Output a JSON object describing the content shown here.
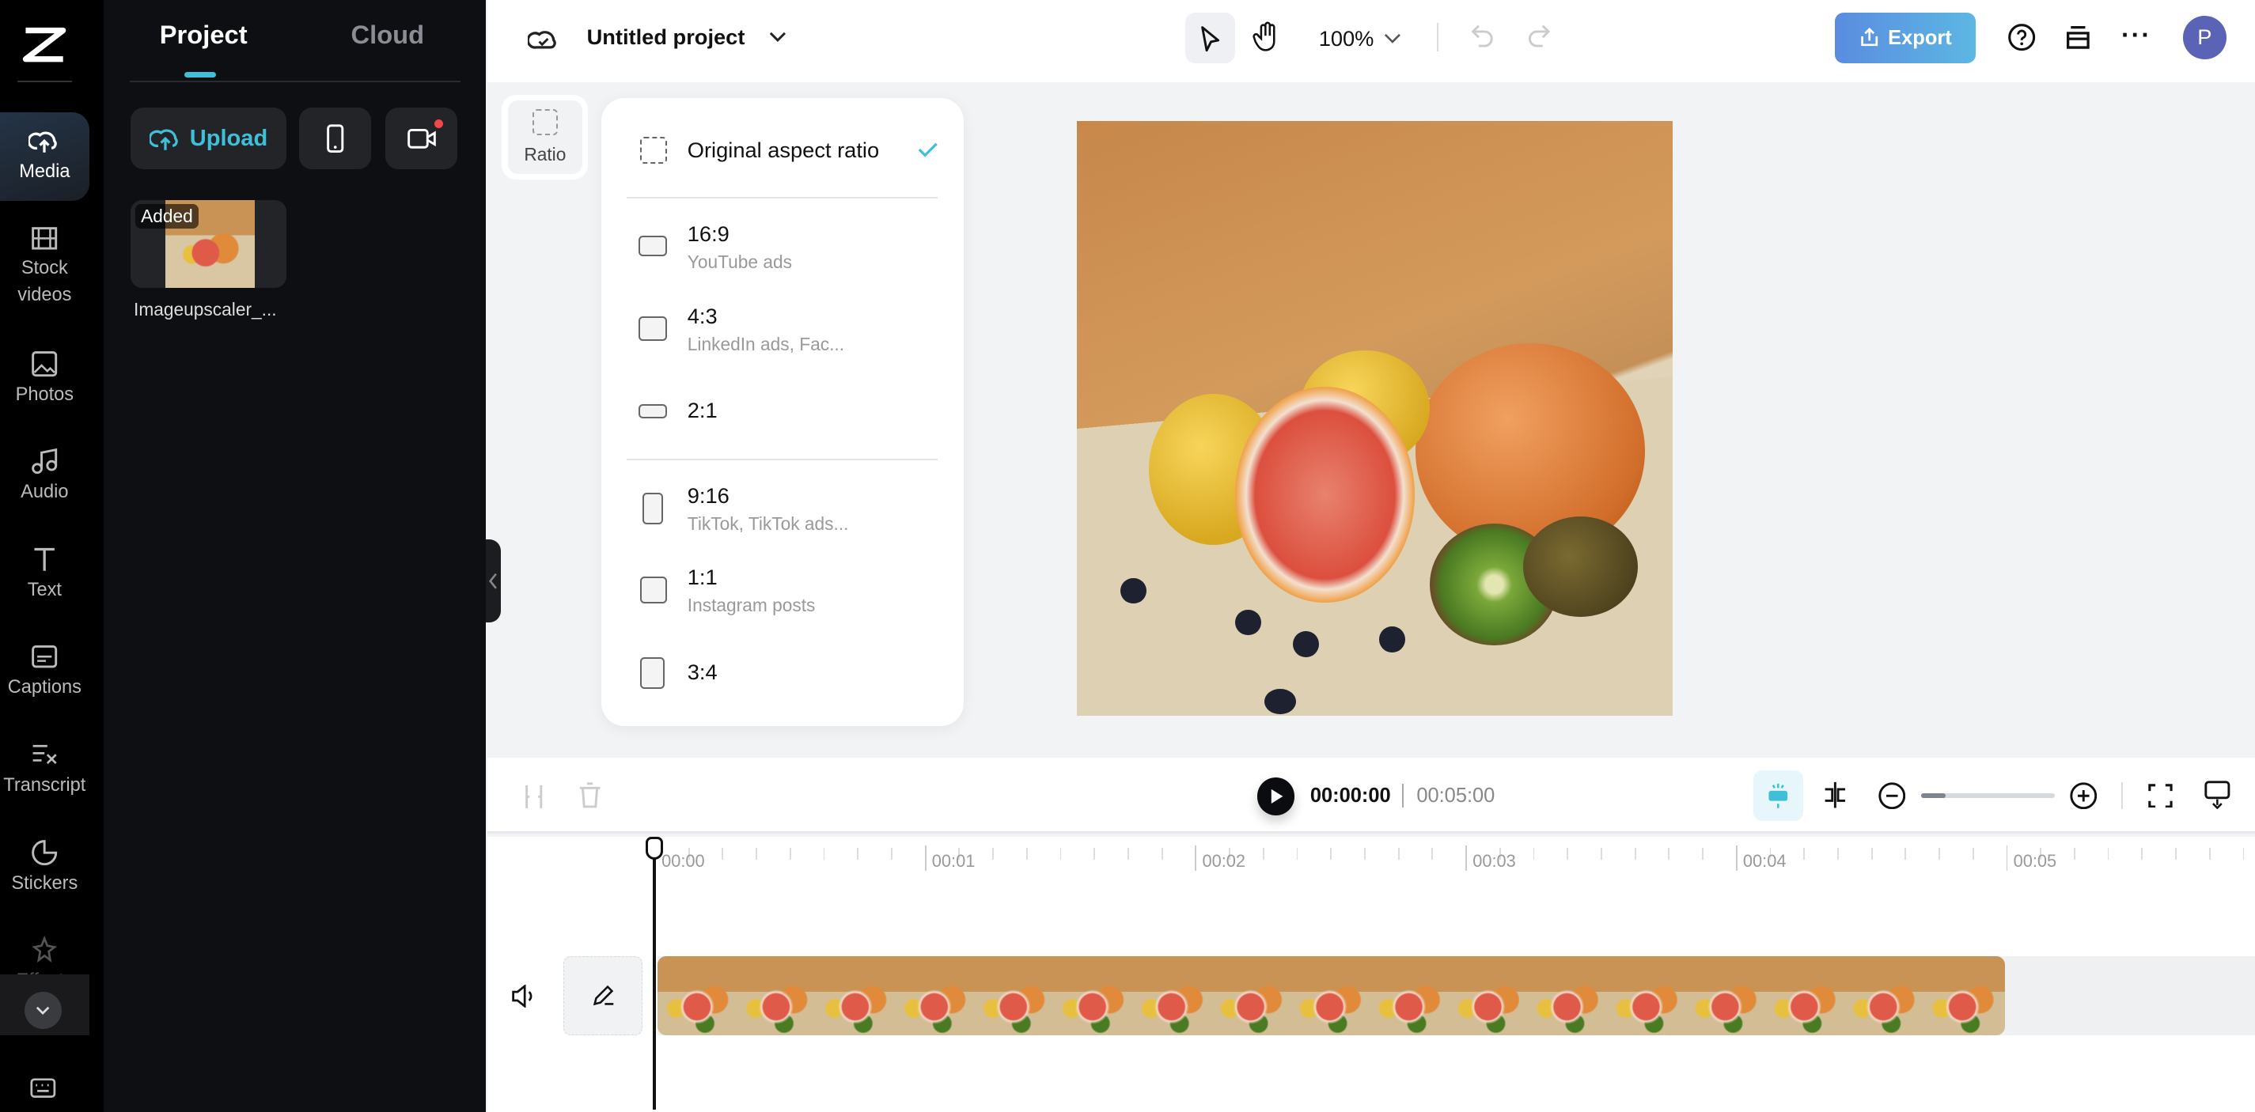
{
  "rail": {
    "items": [
      {
        "label": "Media",
        "icon": "cloud-upload-icon",
        "active": true
      },
      {
        "label": "Stock videos",
        "icon": "film-icon"
      },
      {
        "label": "Photos",
        "icon": "image-icon"
      },
      {
        "label": "Audio",
        "icon": "music-icon"
      },
      {
        "label": "Text",
        "icon": "text-icon"
      },
      {
        "label": "Captions",
        "icon": "captions-icon"
      },
      {
        "label": "Transcript",
        "icon": "transcript-icon"
      },
      {
        "label": "Stickers",
        "icon": "sticker-icon"
      },
      {
        "label": "Effects",
        "icon": "effects-icon"
      }
    ]
  },
  "panel": {
    "tabs": [
      "Project",
      "Cloud"
    ],
    "active_tab": "Project",
    "upload_label": "Upload",
    "media": [
      {
        "badge": "Added",
        "name": "Imageupscaler_..."
      }
    ]
  },
  "header": {
    "project_title": "Untitled project",
    "zoom": "100%",
    "export_label": "Export",
    "avatar_initial": "P",
    "avatar_color": "#5b63b7",
    "export_color": "#4f8fe0"
  },
  "ratio": {
    "button_label": "Ratio",
    "options": [
      {
        "label": "Original aspect ratio",
        "selected": true
      },
      {
        "label": "16:9",
        "sub": "YouTube ads"
      },
      {
        "label": "4:3",
        "sub": "LinkedIn ads, Fac..."
      },
      {
        "label": "2:1"
      },
      {
        "label": "9:16",
        "sub": "TikTok, TikTok ads..."
      },
      {
        "label": "1:1",
        "sub": "Instagram posts"
      },
      {
        "label": "3:4"
      }
    ]
  },
  "player": {
    "current_time": "00:00:00",
    "duration": "00:05:00",
    "timeline_zoom_percent": 10
  },
  "timeline": {
    "ruler": [
      "00:00",
      "00:01",
      "00:02",
      "00:03",
      "00:04",
      "00:05"
    ]
  },
  "accent": "#3fc0d8"
}
